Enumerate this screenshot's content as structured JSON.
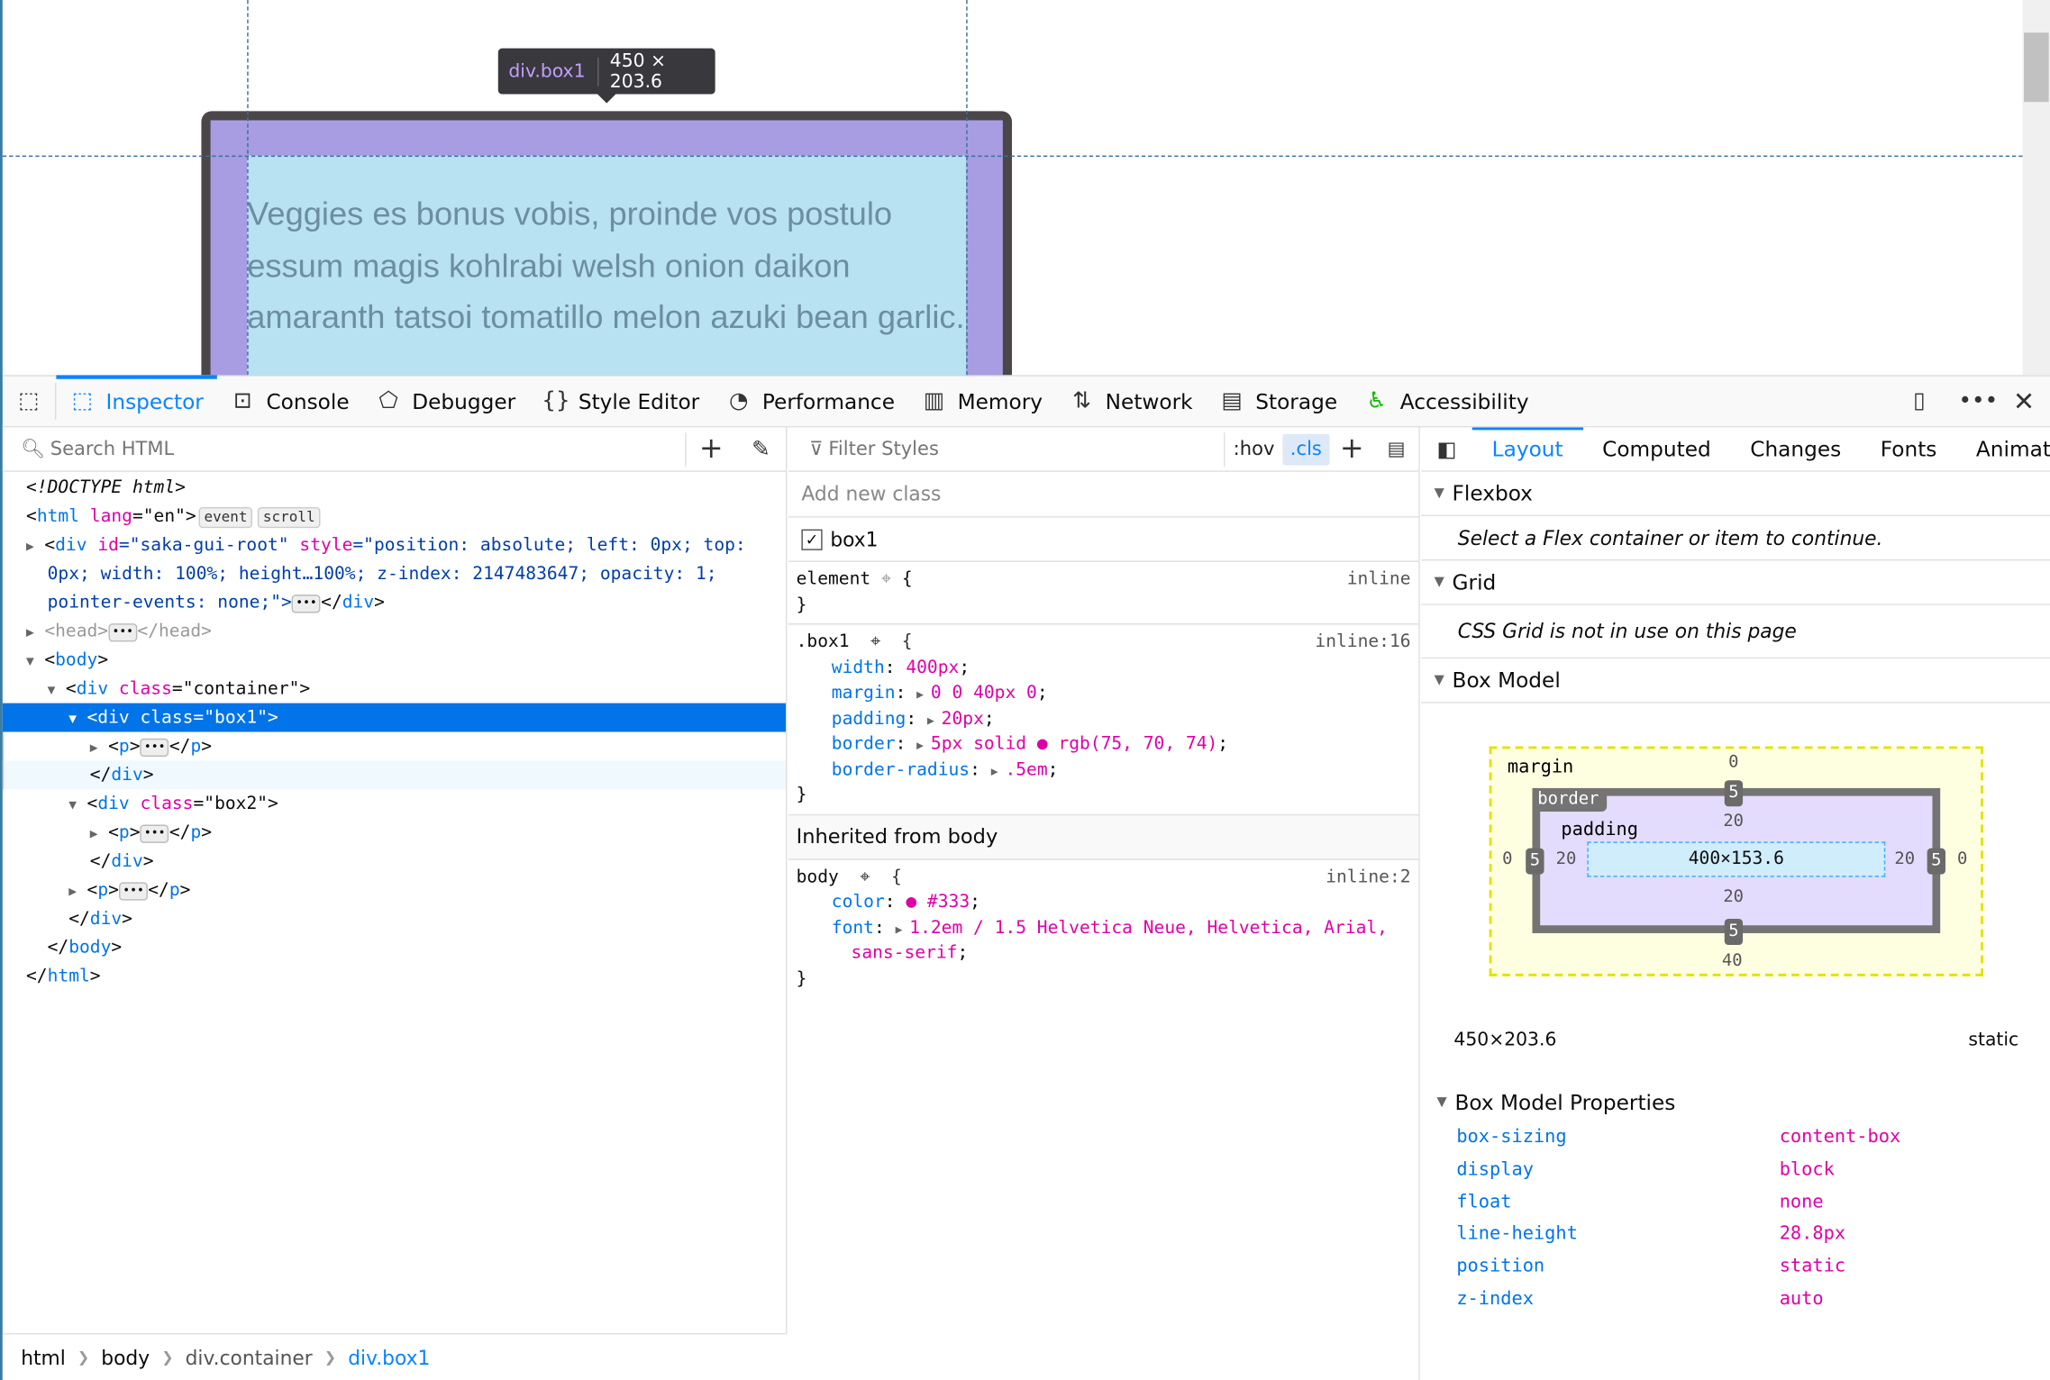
{
  "viewport": {
    "paragraph": "Veggies es bonus vobis, proinde vos postulo essum magis kohlrabi welsh onion daikon amaranth tatsoi tomatillo melon azuki bean garlic.",
    "tooltip_tag": "div.box1",
    "tooltip_size": "450 × 203.6"
  },
  "toolbar": {
    "tabs": [
      {
        "label": "Inspector",
        "icon": "inspector-icon"
      },
      {
        "label": "Console",
        "icon": "console-icon"
      },
      {
        "label": "Debugger",
        "icon": "debugger-icon"
      },
      {
        "label": "Style Editor",
        "icon": "style-editor-icon"
      },
      {
        "label": "Performance",
        "icon": "performance-icon"
      },
      {
        "label": "Memory",
        "icon": "memory-icon"
      },
      {
        "label": "Network",
        "icon": "network-icon"
      },
      {
        "label": "Storage",
        "icon": "storage-icon"
      },
      {
        "label": "Accessibility",
        "icon": "accessibility-icon"
      }
    ],
    "active": "Inspector"
  },
  "markup": {
    "search_placeholder": "Search HTML",
    "lines": [
      [
        {
          "t": "<!DOCTYPE html>",
          "c": "ital"
        }
      ],
      [
        {
          "t": "<",
          "c": ""
        },
        {
          "t": "html",
          "c": "tg"
        },
        {
          "t": " lang",
          "c": "an"
        },
        {
          "t": "=\"en\">",
          "c": ""
        },
        {
          "t": "event",
          "c": "badge"
        },
        {
          "t": "scroll",
          "c": "badge"
        }
      ],
      [
        {
          "t": "▶",
          "c": "tw"
        },
        {
          "t": "<",
          "c": ""
        },
        {
          "t": "div",
          "c": "tg"
        },
        {
          "t": " id",
          "c": "an"
        },
        {
          "t": "=\"saka-gui-root\"",
          "c": "av"
        },
        {
          "t": " style",
          "c": "an"
        },
        {
          "t": "=\"position: absolute; left: 0px; top:",
          "c": "av"
        }
      ],
      [
        {
          "t": "  0px; width: 100%; height…100%; z-index: 2147483647; opacity: 1;",
          "c": "av"
        }
      ],
      [
        {
          "t": "  pointer-events: none;\">",
          "c": "av"
        },
        {
          "t": "•••",
          "c": "ell"
        },
        {
          "t": "</",
          "c": ""
        },
        {
          "t": "div",
          "c": "tg"
        },
        {
          "t": ">",
          "c": ""
        }
      ],
      [
        {
          "t": "▶",
          "c": "tw"
        },
        {
          "t": "<head>",
          "c": "gr"
        },
        {
          "t": "•••",
          "c": "ell"
        },
        {
          "t": "</head>",
          "c": "gr"
        }
      ],
      [
        {
          "t": "▼",
          "c": "tw"
        },
        {
          "t": "<",
          "c": ""
        },
        {
          "t": "body",
          "c": "tg"
        },
        {
          "t": ">",
          "c": ""
        }
      ],
      [
        {
          "t": "  ",
          "c": ""
        },
        {
          "t": "▼",
          "c": "tw"
        },
        {
          "t": "<",
          "c": ""
        },
        {
          "t": "div",
          "c": "tg"
        },
        {
          "t": " class",
          "c": "an"
        },
        {
          "t": "=\"container\">",
          "c": ""
        }
      ],
      [
        {
          "t": "    ",
          "c": ""
        },
        {
          "t": "▼",
          "c": "tw"
        },
        {
          "t": "<div class=\"box1\">",
          "c": ""
        }
      ],
      [
        {
          "t": "      ",
          "c": ""
        },
        {
          "t": "▶",
          "c": "tw"
        },
        {
          "t": "<",
          "c": ""
        },
        {
          "t": "p",
          "c": "tg"
        },
        {
          "t": ">",
          "c": ""
        },
        {
          "t": "•••",
          "c": "ell"
        },
        {
          "t": "</",
          "c": ""
        },
        {
          "t": "p",
          "c": "tg"
        },
        {
          "t": ">",
          "c": ""
        }
      ],
      [
        {
          "t": "      </",
          "c": ""
        },
        {
          "t": "div",
          "c": "tg"
        },
        {
          "t": ">",
          "c": ""
        }
      ],
      [
        {
          "t": "    ",
          "c": ""
        },
        {
          "t": "▼",
          "c": "tw"
        },
        {
          "t": "<",
          "c": ""
        },
        {
          "t": "div",
          "c": "tg"
        },
        {
          "t": " class",
          "c": "an"
        },
        {
          "t": "=\"box2\">",
          "c": ""
        }
      ],
      [
        {
          "t": "      ",
          "c": ""
        },
        {
          "t": "▶",
          "c": "tw"
        },
        {
          "t": "<",
          "c": ""
        },
        {
          "t": "p",
          "c": "tg"
        },
        {
          "t": ">",
          "c": ""
        },
        {
          "t": "•••",
          "c": "ell"
        },
        {
          "t": "</",
          "c": ""
        },
        {
          "t": "p",
          "c": "tg"
        },
        {
          "t": ">",
          "c": ""
        }
      ],
      [
        {
          "t": "      </",
          "c": ""
        },
        {
          "t": "div",
          "c": "tg"
        },
        {
          "t": ">",
          "c": ""
        }
      ],
      [
        {
          "t": "    ",
          "c": ""
        },
        {
          "t": "▶",
          "c": "tw"
        },
        {
          "t": "<",
          "c": ""
        },
        {
          "t": "p",
          "c": "tg"
        },
        {
          "t": ">",
          "c": ""
        },
        {
          "t": "•••",
          "c": "ell"
        },
        {
          "t": "</",
          "c": ""
        },
        {
          "t": "p",
          "c": "tg"
        },
        {
          "t": ">",
          "c": ""
        }
      ],
      [
        {
          "t": "    </",
          "c": ""
        },
        {
          "t": "div",
          "c": "tg"
        },
        {
          "t": ">",
          "c": ""
        }
      ],
      [
        {
          "t": "  </",
          "c": ""
        },
        {
          "t": "body",
          "c": "tg"
        },
        {
          "t": ">",
          "c": ""
        }
      ],
      [
        {
          "t": "</",
          "c": ""
        },
        {
          "t": "html",
          "c": "tg"
        },
        {
          "t": ">",
          "c": ""
        }
      ]
    ],
    "selected_line": 8,
    "hover_line": 10
  },
  "breadcrumbs": [
    "html",
    "body",
    "div.container",
    "div.box1"
  ],
  "rules": {
    "filter_placeholder": "Filter Styles",
    "hov": ":hov",
    "cls": ".cls",
    "add_class_placeholder": "Add new class",
    "class_name": "box1",
    "element": {
      "selector": "element",
      "source": "inline"
    },
    "box1": {
      "selector": ".box1",
      "source": "inline:16",
      "decls": [
        [
          "width",
          "400px"
        ],
        [
          "margin",
          "0 0 40px 0"
        ],
        [
          "padding",
          "20px"
        ],
        [
          "border",
          "5px solid ● rgb(75, 70, 74)"
        ],
        [
          "border-radius",
          ".5em"
        ]
      ]
    },
    "inherited_header": "Inherited from body",
    "body": {
      "selector": "body",
      "source": "inline:2",
      "decls": [
        [
          "color",
          "● #333"
        ],
        [
          "font",
          "1.2em / 1.5 Helvetica Neue, Helvetica, Arial,"
        ]
      ],
      "cont": "sans-serif"
    }
  },
  "layout": {
    "tabs": [
      "Layout",
      "Computed",
      "Changes",
      "Fonts",
      "Animati"
    ],
    "active": "Layout",
    "flexbox_title": "Flexbox",
    "flexbox_msg": "Select a Flex container or item to continue.",
    "grid_title": "Grid",
    "grid_msg": "CSS Grid is not in use on this page",
    "boxmodel_title": "Box Model",
    "box": {
      "margin_label": "margin",
      "border_label": "border",
      "padding_label": "padding",
      "margin": {
        "top": "0",
        "right": "0",
        "bottom": "40",
        "left": "0"
      },
      "border": {
        "top": "5",
        "right": "5",
        "bottom": "5",
        "left": "5"
      },
      "padding": {
        "top": "20",
        "right": "20",
        "bottom": "20",
        "left": "20"
      },
      "content": "400×153.6"
    },
    "size": "450×203.6",
    "position": "static",
    "props_title": "Box Model Properties",
    "props": [
      [
        "box-sizing",
        "content-box"
      ],
      [
        "display",
        "block"
      ],
      [
        "float",
        "none"
      ],
      [
        "line-height",
        "28.8px"
      ],
      [
        "position",
        "static"
      ],
      [
        "z-index",
        "auto"
      ]
    ]
  }
}
